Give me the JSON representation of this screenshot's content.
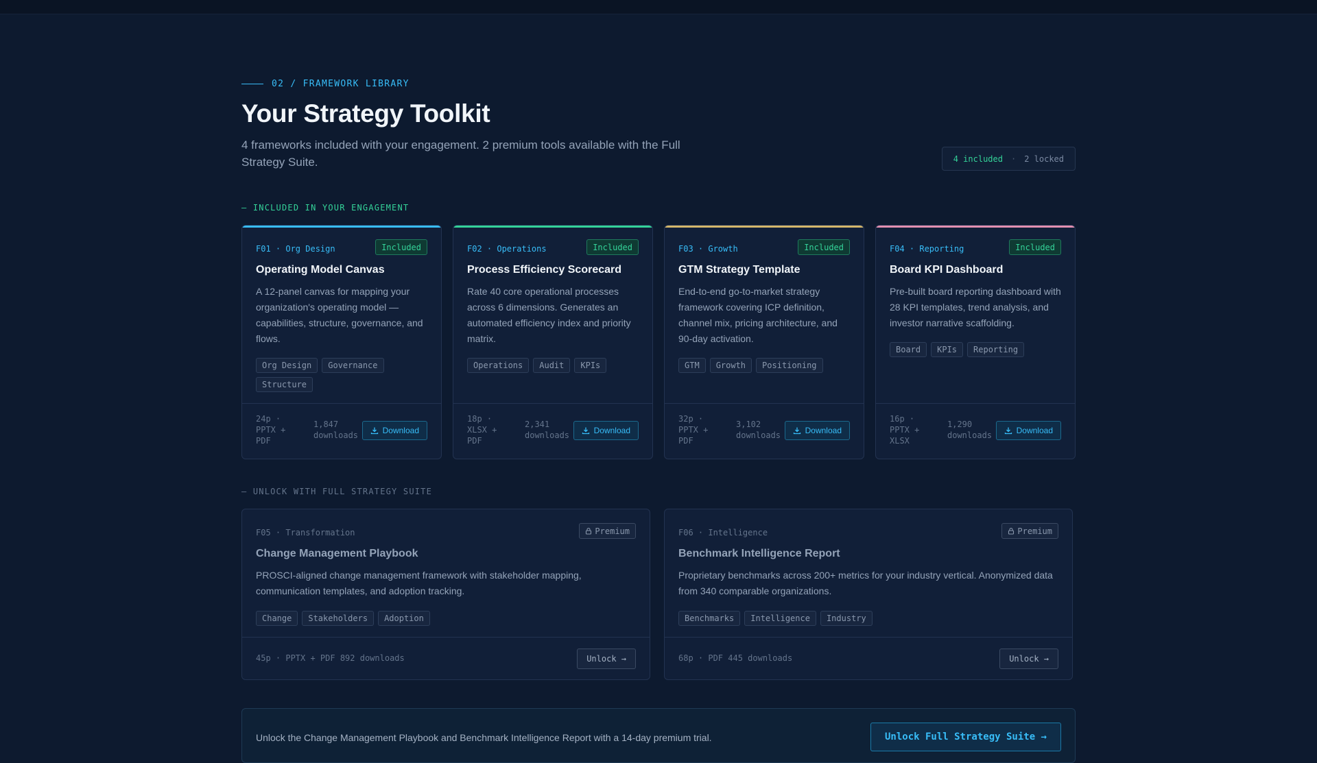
{
  "header": {
    "eyebrow": "02 / FRAMEWORK LIBRARY",
    "title": "Your Strategy Toolkit",
    "subtitle": "4 frameworks included with your engagement. 2 premium tools available with the Full Strategy Suite.",
    "counter": {
      "included": "4 included",
      "separator": "·",
      "locked": "2 locked"
    }
  },
  "sections": {
    "included_label": "— INCLUDED IN YOUR ENGAGEMENT",
    "locked_label": "— UNLOCK WITH FULL STRATEGY SUITE"
  },
  "included": [
    {
      "meta": "F01 · Org Design",
      "badge": "Included",
      "title": "Operating Model Canvas",
      "description": "A 12-panel canvas for mapping your organization's operating model — capabilities, structure, governance, and flows.",
      "tags": [
        "Org Design",
        "Governance",
        "Structure"
      ],
      "format": "24p · PPTX + PDF",
      "downloads": "1,847 downloads",
      "button": "Download",
      "accent": "#38bdf8"
    },
    {
      "meta": "F02 · Operations",
      "badge": "Included",
      "title": "Process Efficiency Scorecard",
      "description": "Rate 40 core operational processes across 6 dimensions. Generates an automated efficiency index and priority matrix.",
      "tags": [
        "Operations",
        "Audit",
        "KPIs"
      ],
      "format": "18p · XLSX + PDF",
      "downloads": "2,341 downloads",
      "button": "Download",
      "accent": "#34d399"
    },
    {
      "meta": "F03 · Growth",
      "badge": "Included",
      "title": "GTM Strategy Template",
      "description": "End-to-end go-to-market strategy framework covering ICP definition, channel mix, pricing architecture, and 90-day activation.",
      "tags": [
        "GTM",
        "Growth",
        "Positioning"
      ],
      "format": "32p · PPTX + PDF",
      "downloads": "3,102 downloads",
      "button": "Download",
      "accent": "#d4b66a"
    },
    {
      "meta": "F04 · Reporting",
      "badge": "Included",
      "title": "Board KPI Dashboard",
      "description": "Pre-built board reporting dashboard with 28 KPI templates, trend analysis, and investor narrative scaffolding.",
      "tags": [
        "Board",
        "KPIs",
        "Reporting"
      ],
      "format": "16p · PPTX + XLSX",
      "downloads": "1,290 downloads",
      "button": "Download",
      "accent": "#e28fb0"
    }
  ],
  "premium": [
    {
      "meta": "F05 · Transformation",
      "badge": "Premium",
      "title": "Change Management Playbook",
      "description": "PROSCI-aligned change management framework with stakeholder mapping, communication templates, and adoption tracking.",
      "tags": [
        "Change",
        "Stakeholders",
        "Adoption"
      ],
      "stats": "45p · PPTX + PDF  892 downloads",
      "button": "Unlock →"
    },
    {
      "meta": "F06 · Intelligence",
      "badge": "Premium",
      "title": "Benchmark Intelligence Report",
      "description": "Proprietary benchmarks across 200+ metrics for your industry vertical. Anonymized data from 340 comparable organizations.",
      "tags": [
        "Benchmarks",
        "Intelligence",
        "Industry"
      ],
      "stats": "68p · PDF  445 downloads",
      "button": "Unlock →"
    }
  ],
  "cta": {
    "text": "Unlock the Change Management Playbook and Benchmark Intelligence Report with a 14-day premium trial.",
    "button": "Unlock Full Strategy Suite →"
  },
  "icons": {
    "download": "download-icon",
    "lock": "lock-icon"
  }
}
